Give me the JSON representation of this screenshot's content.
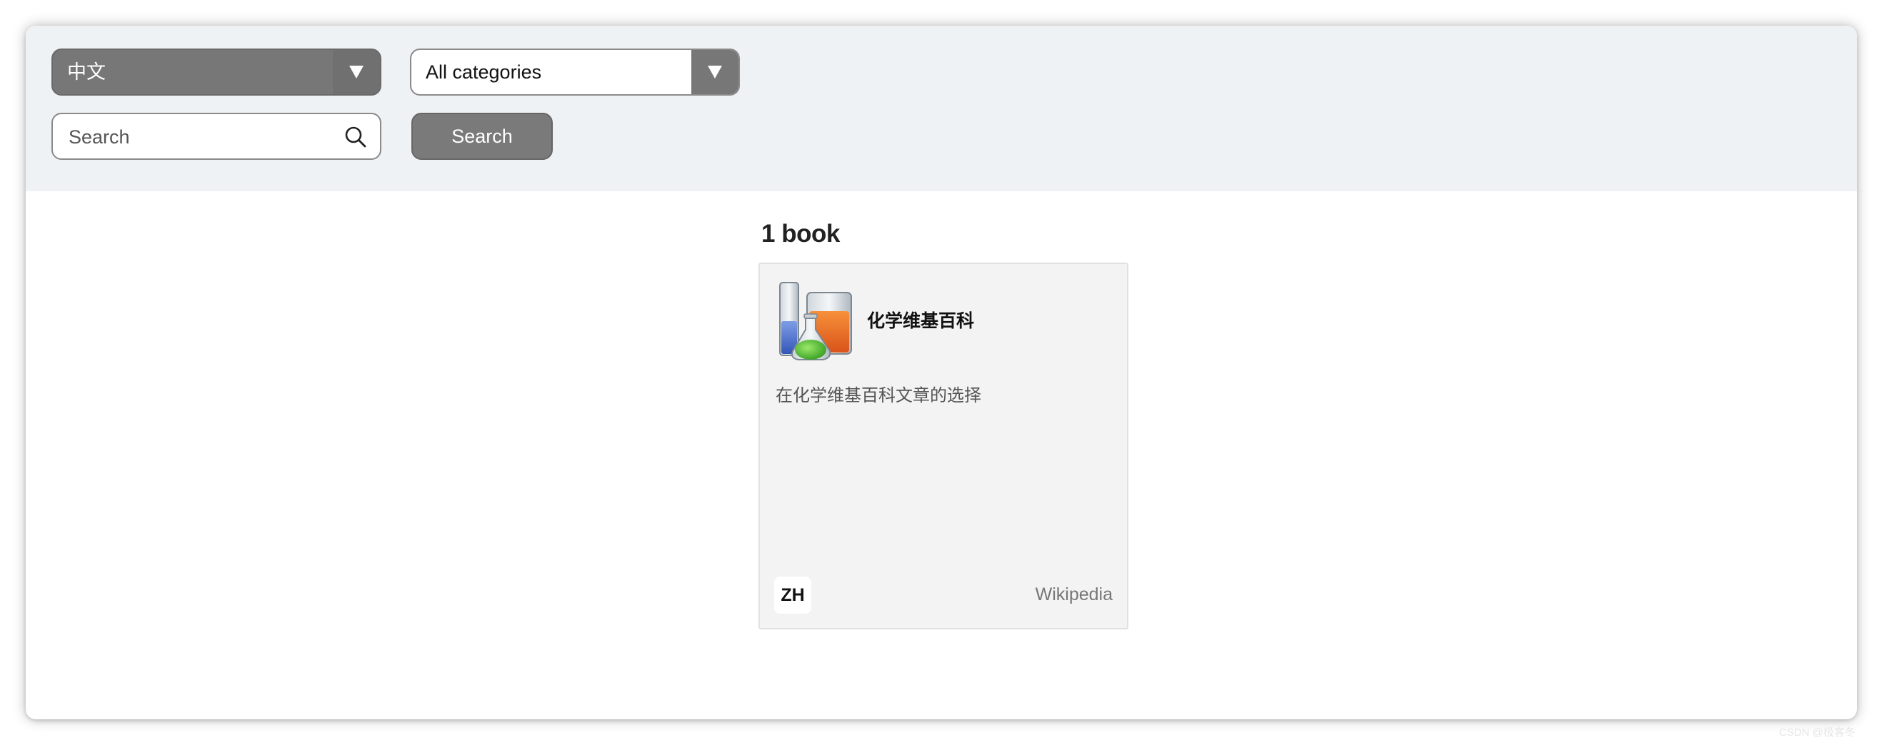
{
  "filters": {
    "language": "中文",
    "category": "All categories"
  },
  "search": {
    "placeholder": "Search",
    "button_label": "Search"
  },
  "results": {
    "count_label": "1 book",
    "books": [
      {
        "title": "化学维基百科",
        "description": "在化学维基百科文章的选择",
        "language": "ZH",
        "publisher": "Wikipedia",
        "icon": "chemistry-glassware-icon"
      }
    ]
  },
  "watermark": "CSDN @极客冬"
}
